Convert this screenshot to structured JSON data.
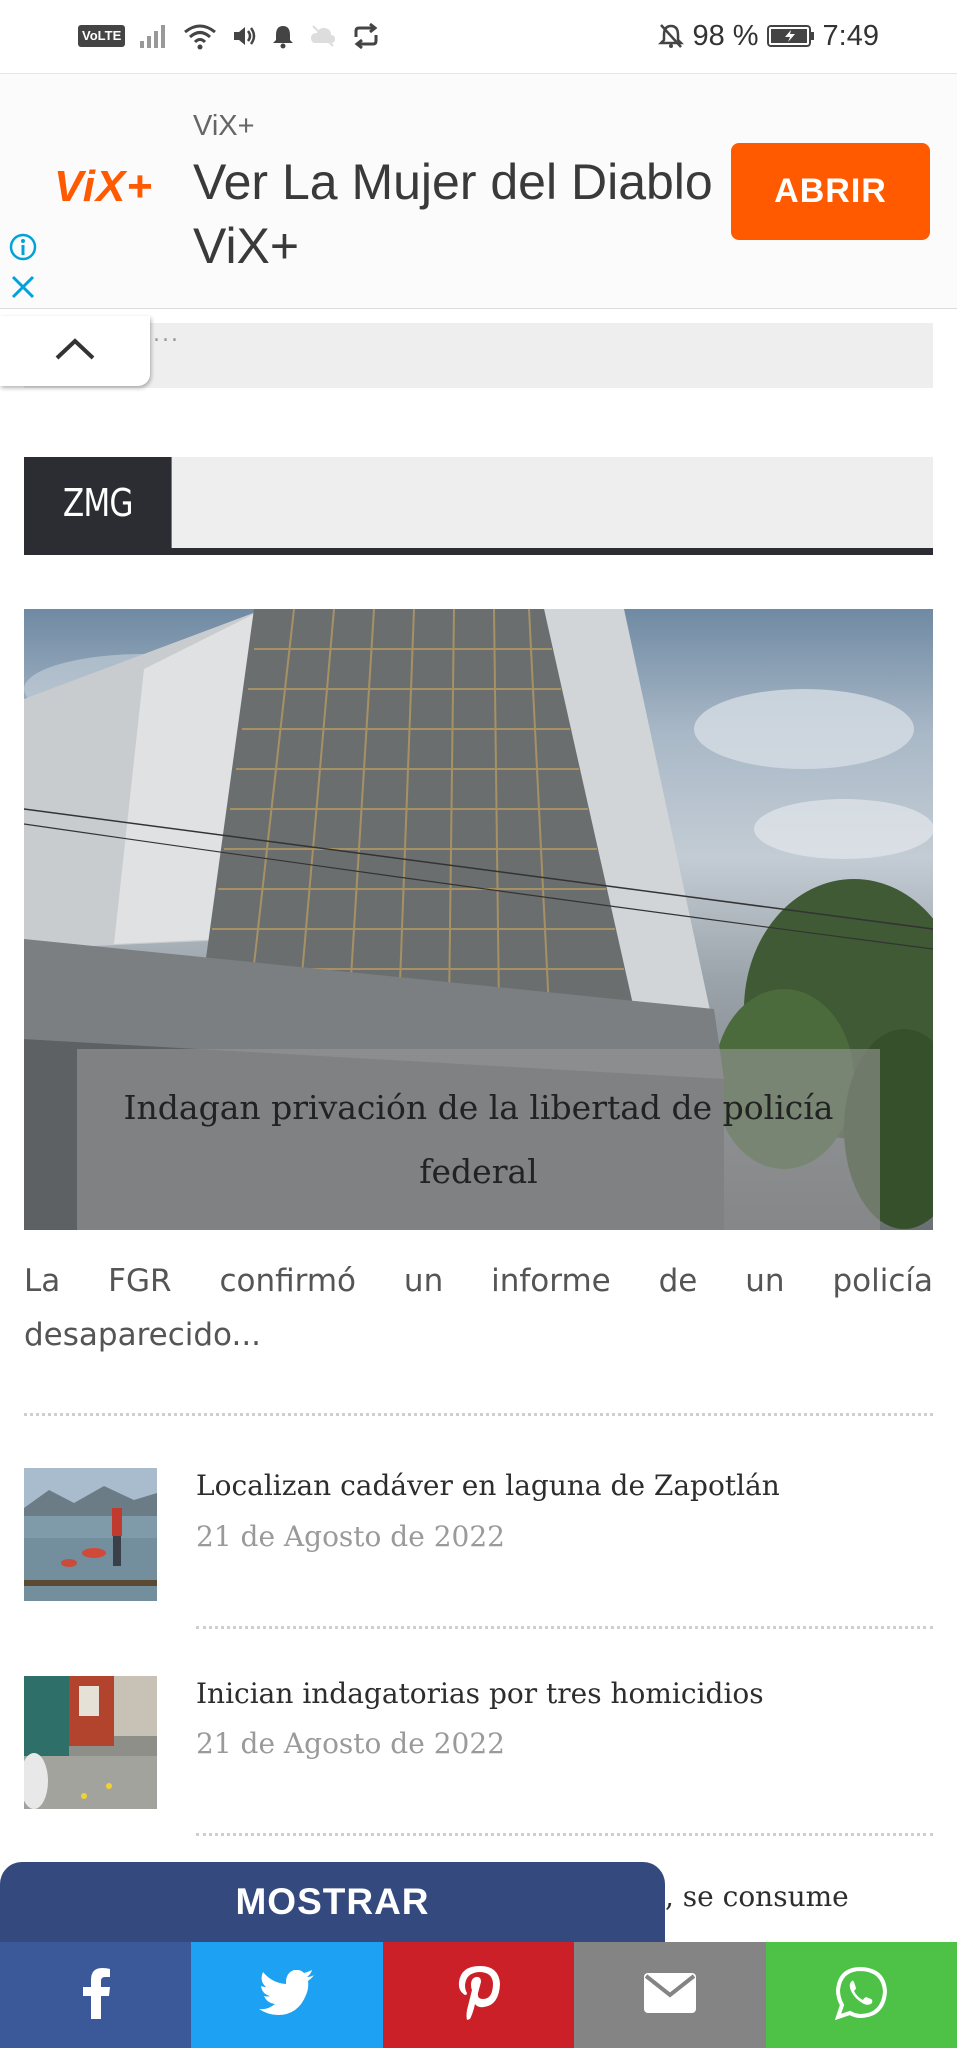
{
  "status_bar": {
    "volte": "VoLTE",
    "battery_percent": "98 %",
    "time": "7:49"
  },
  "ad": {
    "logo_text": "ViX+",
    "brand": "ViX+",
    "title": "Ver La Mujer del Diablo ViX+",
    "cta_label": "ABRIR",
    "accent_color": "#ff5a00"
  },
  "collapse": {
    "dots": "..."
  },
  "section": {
    "label": "ZMG"
  },
  "hero": {
    "caption": "Indagan privación de la libertad de policía federal",
    "excerpt_line1": [
      "La",
      "FGR",
      "confirmó",
      "un",
      "informe",
      "de",
      "un",
      "policía"
    ],
    "excerpt_line2": "desaparecido..."
  },
  "articles": [
    {
      "title": "Localizan cadáver en laguna de Zapotlán",
      "date": "21 de Agosto de 2022"
    },
    {
      "title": "Inician indagatorias por tres homicidios",
      "date": "21 de Agosto de 2022"
    }
  ],
  "popup": {
    "button_label": "MOSTRAR",
    "peek_text": ", se consume"
  },
  "share": {
    "buttons": [
      {
        "name": "facebook",
        "color": "#3b5998"
      },
      {
        "name": "twitter",
        "color": "#1da1f2"
      },
      {
        "name": "pinterest",
        "color": "#cb2027"
      },
      {
        "name": "email",
        "color": "#848484"
      },
      {
        "name": "whatsapp",
        "color": "#4dc247"
      }
    ]
  }
}
